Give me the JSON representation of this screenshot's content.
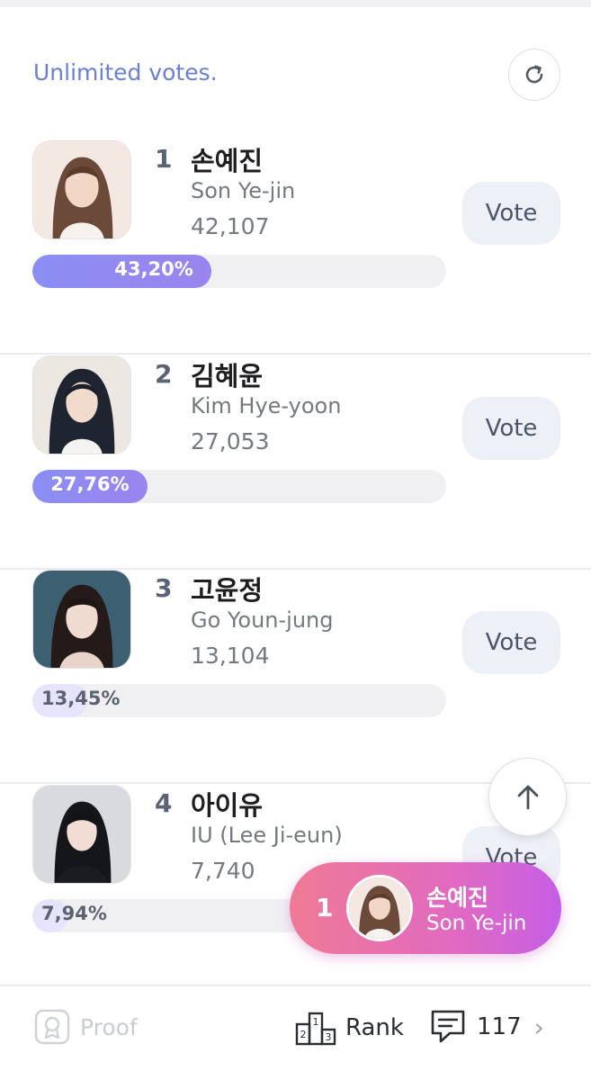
{
  "header": {
    "notice": "Unlimited votes."
  },
  "entries": [
    {
      "rank": "1",
      "name_ko": "손예진",
      "name_en": "Son Ye-jin",
      "votes": "42,107",
      "percent_label": "43,20%",
      "percent": 43.2,
      "vote_label": "Vote",
      "bar_color": "#8b8cf2",
      "label_color": "#ffffff"
    },
    {
      "rank": "2",
      "name_ko": "김혜윤",
      "name_en": "Kim Hye-yoon",
      "votes": "27,053",
      "percent_label": "27,76%",
      "percent": 27.76,
      "vote_label": "Vote",
      "bar_color": "#8e86f0",
      "label_color": "#ffffff"
    },
    {
      "rank": "3",
      "name_ko": "고윤정",
      "name_en": "Go Youn-jung",
      "votes": "13,104",
      "percent_label": "13,45%",
      "percent": 13.45,
      "vote_label": "Vote",
      "bar_color": "#e6e4fb",
      "label_color": "#5d6270"
    },
    {
      "rank": "4",
      "name_ko": "아이유",
      "name_en": "IU (Lee Ji-eun)",
      "votes": "7,740",
      "percent_label": "7,94%",
      "percent": 7.94,
      "vote_label": "Vote",
      "bar_color": "#e6e4fb",
      "label_color": "#5d6270"
    }
  ],
  "leader": {
    "rank": "1",
    "name_ko": "손예진",
    "name_en": "Son Ye-jin"
  },
  "footer": {
    "proof_label": "Proof",
    "rank_label": "Rank",
    "comment_count": "117"
  },
  "icons": {
    "refresh": "refresh-icon",
    "up": "arrow-up-icon",
    "proof": "certificate-icon",
    "rank": "podium-icon",
    "comment": "comment-icon",
    "chevron": "chevron-right-icon"
  }
}
